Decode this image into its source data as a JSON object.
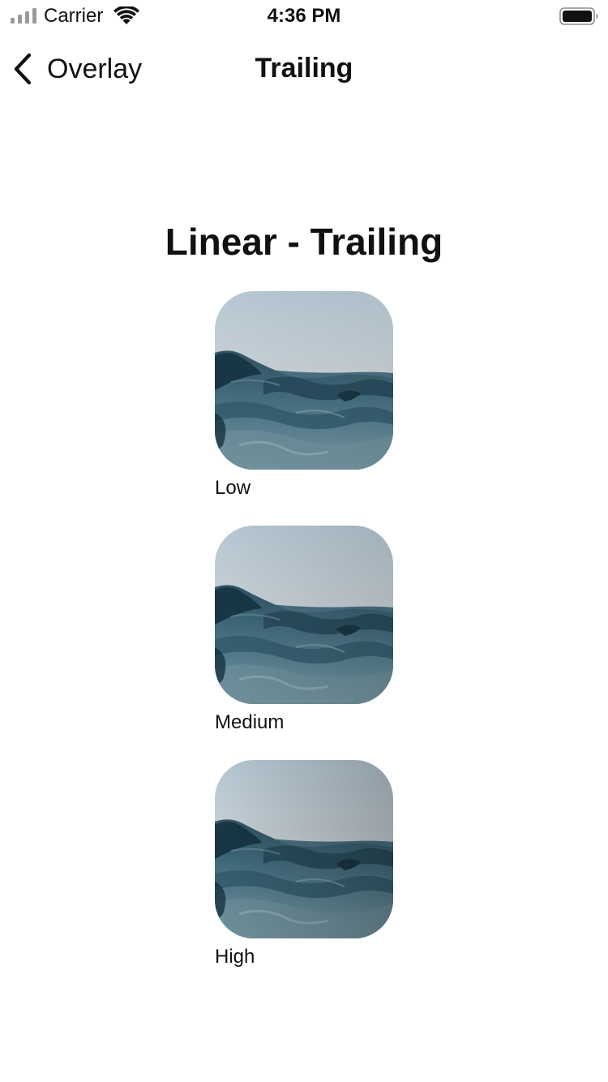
{
  "status_bar": {
    "carrier": "Carrier",
    "time": "4:36 PM",
    "icons": [
      "signal-icon",
      "wifi-icon",
      "battery-icon"
    ]
  },
  "nav": {
    "back_label": "Overlay",
    "title": "Trailing",
    "back_icon": "chevron-left-icon"
  },
  "content": {
    "section_title": "Linear - Trailing",
    "cards": [
      {
        "label": "Low"
      },
      {
        "label": "Medium"
      },
      {
        "label": "High"
      }
    ]
  },
  "colors": {
    "text": "#111111",
    "sky_top": "#b9cbd6",
    "sky_horizon": "#dcc7c2",
    "water_dark": "#1d3a48",
    "water_mid": "#3f6576"
  }
}
